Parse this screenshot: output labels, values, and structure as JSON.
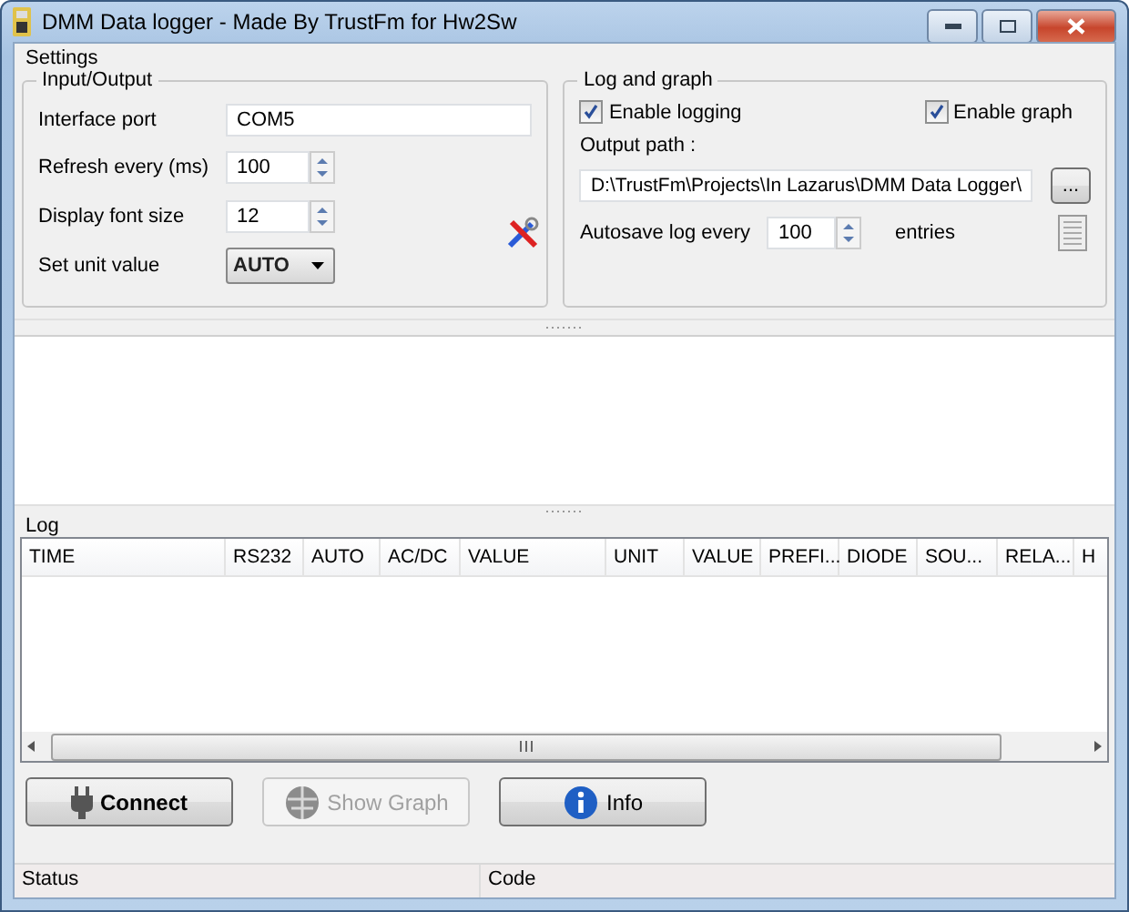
{
  "window": {
    "title": "DMM Data logger - Made By TrustFm for Hw2Sw"
  },
  "settings": {
    "label": "Settings",
    "input_output": {
      "title": "Input/Output",
      "fields": [
        {
          "kind": "text",
          "label": "Interface port",
          "value": "COM5"
        },
        {
          "kind": "spin",
          "label": "Refresh every (ms)",
          "value": "100"
        },
        {
          "kind": "spin",
          "label": "Display font size",
          "value": "12"
        },
        {
          "kind": "dropdown",
          "label": "Set unit value",
          "value": "AUTO"
        }
      ]
    },
    "log_and_graph": {
      "title": "Log and graph",
      "checkboxes": [
        {
          "label": "Enable logging",
          "checked": true
        },
        {
          "label": "Enable graph",
          "checked": true
        }
      ],
      "output_path_label": "Output path :",
      "output_path": "D:\\TrustFm\\Projects\\In Lazarus\\DMM Data Logger\\",
      "browse": "...",
      "autosave_label": "Autosave log every",
      "autosave_value": "100",
      "autosave_suffix": "entries"
    }
  },
  "log": {
    "title": "Log",
    "columns": [
      "TIME",
      "RS232",
      "AUTO",
      "AC/DC",
      "VALUE",
      "UNIT",
      "VALUE",
      "PREFI...",
      "DIODE",
      "SOU...",
      "RELA...",
      "H"
    ]
  },
  "buttons": [
    {
      "kind": "connect",
      "label": "Connect",
      "disabled": false
    },
    {
      "kind": "graph",
      "label": "Show Graph",
      "disabled": true
    },
    {
      "kind": "info",
      "label": "Info",
      "disabled": false
    }
  ],
  "status_bar": [
    "Status",
    "Code"
  ]
}
